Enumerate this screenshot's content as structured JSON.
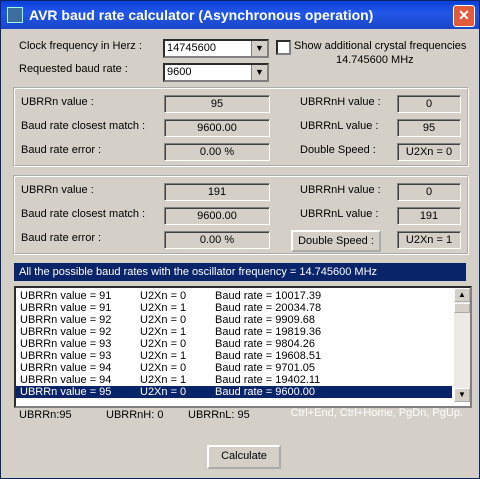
{
  "window": {
    "title": "AVR baud rate calculator  (Asynchronous operation)",
    "close_label": "✕"
  },
  "inputs": {
    "clock_label": "Clock frequency in Herz :",
    "clock_value": "14745600",
    "baud_label": "Requested baud rate :",
    "baud_value": "9600",
    "show_crystal_label": "Show additional crystal frequencies",
    "crystal_freq": "14.745600 MHz"
  },
  "group1": {
    "ubrr_label": "UBRRn value :",
    "ubrr": "95",
    "closest_label": "Baud rate closest match :",
    "closest": "9600.00",
    "error_label": "Baud rate error :",
    "error": "0.00 %",
    "ubrrh_label": "UBRRnH value :",
    "ubrrh": "0",
    "ubrrl_label": "UBRRnL value :",
    "ubrrl": "95",
    "ds_label": "Double Speed :",
    "u2x": "U2Xn = 0"
  },
  "group2": {
    "ubrr_label": "UBRRn value :",
    "ubrr": "191",
    "closest_label": "Baud rate closest match :",
    "closest": "9600.00",
    "error_label": "Baud rate error :",
    "error": "0.00 %",
    "ubrrh_label": "UBRRnH value :",
    "ubrrh": "0",
    "ubrrl_label": "UBRRnL value :",
    "ubrrl": "191",
    "ds_button": "Double Speed :",
    "u2x": "U2Xn = 1"
  },
  "list": {
    "header": "All the possible baud rates with the oscillator frequency = 14.745600 MHz",
    "rows": [
      [
        "UBRRn value = 91",
        "U2Xn = 0",
        "Baud rate = 10017.39"
      ],
      [
        "UBRRn value = 91",
        "U2Xn = 1",
        "Baud rate = 20034.78"
      ],
      [
        "UBRRn value = 92",
        "U2Xn = 0",
        "Baud rate = 9909.68"
      ],
      [
        "UBRRn value = 92",
        "U2Xn = 1",
        "Baud rate = 19819.36"
      ],
      [
        "UBRRn value = 93",
        "U2Xn = 0",
        "Baud rate = 9804.26"
      ],
      [
        "UBRRn value = 93",
        "U2Xn = 1",
        "Baud rate = 19608.51"
      ],
      [
        "UBRRn value = 94",
        "U2Xn = 0",
        "Baud rate = 9701.05"
      ],
      [
        "UBRRn value = 94",
        "U2Xn = 1",
        "Baud rate = 19402.11"
      ],
      [
        "UBRRn value = 95",
        "U2Xn = 0",
        "Baud rate = 9600.00"
      ]
    ],
    "selected_index": 8
  },
  "status": {
    "ubrr": "UBRRn:95",
    "ubrrh": "UBRRnH: 0",
    "ubrrl": "UBRRnL: 95",
    "hint": "Ctrl+End, Ctrl+Home, PgDn, PgUp."
  },
  "actions": {
    "calculate": "Calculate"
  }
}
